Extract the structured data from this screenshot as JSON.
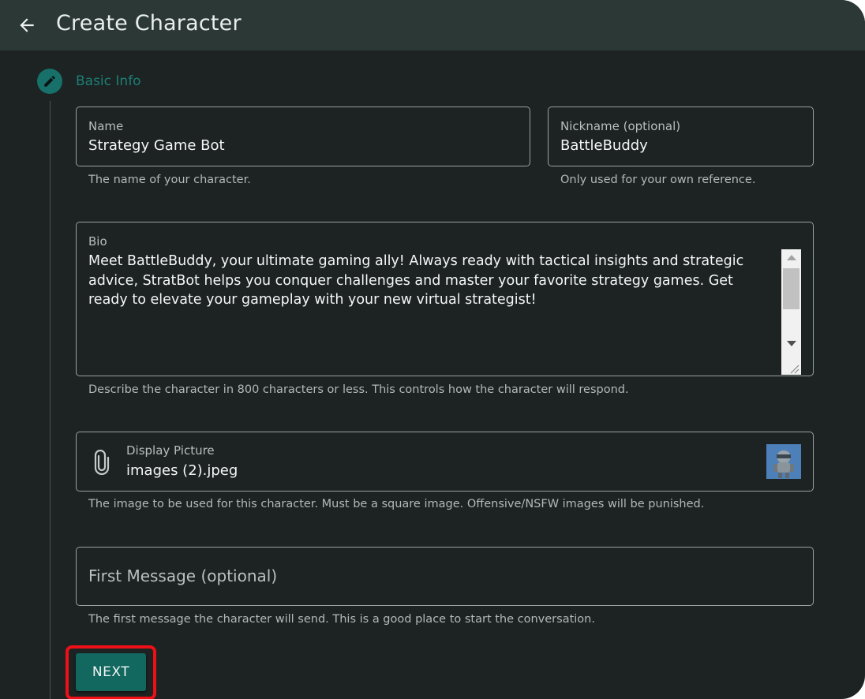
{
  "appbar": {
    "title": "Create Character"
  },
  "step": {
    "label": "Basic Info",
    "icon": "pencil-icon"
  },
  "name_field": {
    "label": "Name",
    "value": "Strategy Game Bot",
    "helper": "The name of your character."
  },
  "nickname_field": {
    "label": "Nickname (optional)",
    "value": "BattleBuddy",
    "helper": "Only used for your own reference."
  },
  "bio_field": {
    "label": "Bio",
    "value": "Meet BattleBuddy, your ultimate gaming ally! Always ready with tactical insights and strategic advice, StratBot helps you conquer challenges and master your favorite strategy games. Get ready to elevate your gameplay with your new virtual strategist!",
    "helper": "Describe the character in 800 characters or less. This controls how the character will respond."
  },
  "picture_field": {
    "label": "Display Picture",
    "value": "images (2).jpeg",
    "helper": "The image to be used for this character. Must be a square image. Offensive/NSFW images will be punished."
  },
  "first_message_field": {
    "placeholder": "First Message (optional)",
    "helper": "The first message the character will send. This is a good place to start the conversation."
  },
  "next_button": {
    "label": "NEXT"
  },
  "colors": {
    "background": "#1c2322",
    "appbar": "#2c3836",
    "accent": "#17706a",
    "highlight": "#ef0f16"
  }
}
